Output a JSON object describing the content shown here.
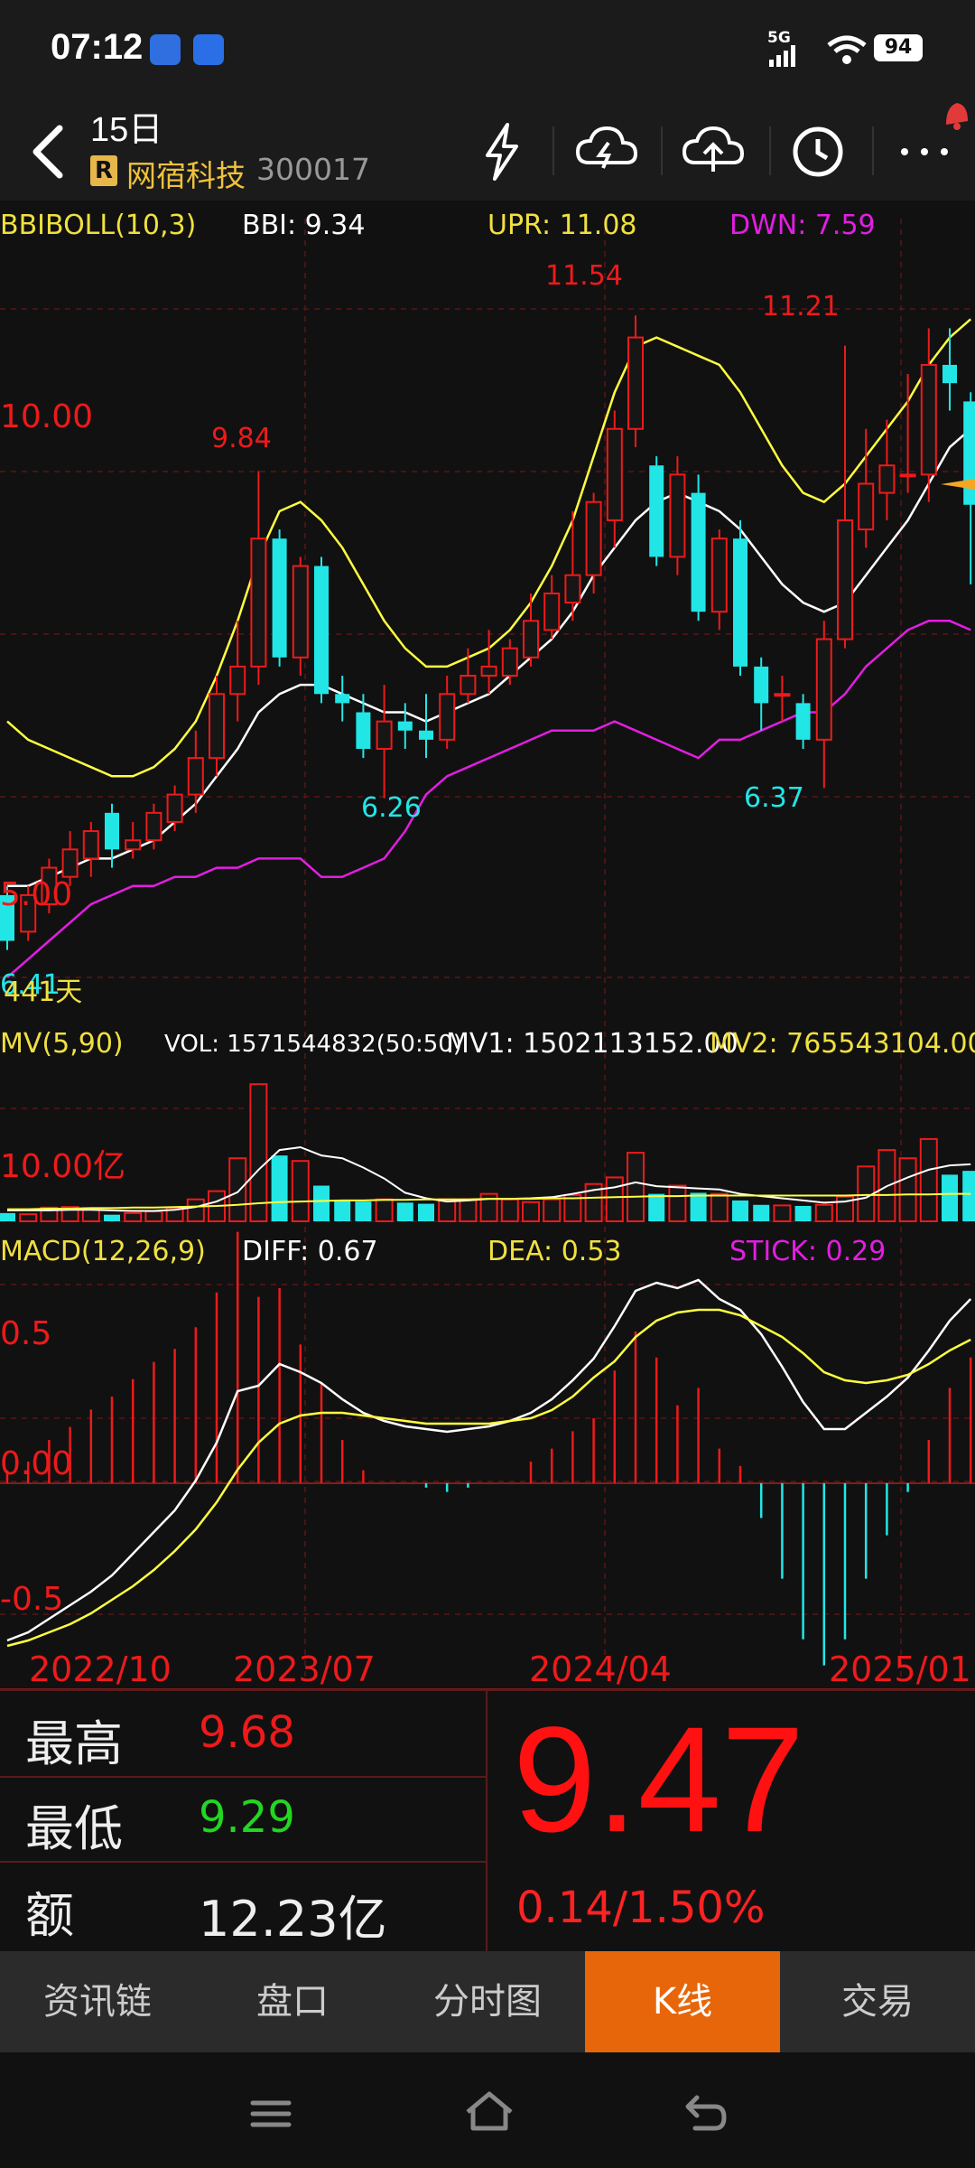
{
  "status": {
    "time": "07:12",
    "network": "5G",
    "battery": "94"
  },
  "header": {
    "period": "15日",
    "badge": "R",
    "stock_name": "网宿科技",
    "stock_code": "300017"
  },
  "indicators": {
    "boll": {
      "name": "BBIBOLL(10,3)",
      "bbi": "BBI: 9.34",
      "upr": "UPR: 11.08",
      "dwn": "DWN: 7.59"
    },
    "mv": {
      "name": "MV(5,90)",
      "vol": "VOL: 1571544832(50:50)",
      "mv1": "MV1: 1502113152.00",
      "mv2": "MV2: 765543104.00"
    },
    "macd": {
      "name": "MACD(12,26,9)",
      "diff": "DIFF: 0.67",
      "dea": "DEA: 0.53",
      "stick": "STICK: 0.29"
    }
  },
  "chart_labels": {
    "price_axis_high": "10.00",
    "price_axis_low": "5.00",
    "volume_axis": "10.00亿",
    "macd_axis_top": "0.5",
    "macd_axis_mid": "0.00",
    "macd_axis_bottom": "-0.5",
    "days_label": "441天",
    "peak_1": "9.84",
    "peak_2": "11.54",
    "peak_3": "11.21",
    "trough_1": "6.26",
    "trough_2": "6.37",
    "start_low": "6.41"
  },
  "chart_data": {
    "type": "candlestick",
    "x_ticks": [
      "2022/10",
      "2023/07",
      "2024/04",
      "2025/01"
    ],
    "price_ylim": [
      4.3,
      12.6
    ],
    "candles": [
      {
        "o": 5.2,
        "c": 4.7,
        "h": 5.3,
        "l": 4.6
      },
      {
        "o": 4.8,
        "c": 5.2,
        "h": 5.3,
        "l": 4.7
      },
      {
        "o": 5.1,
        "c": 5.5,
        "h": 5.6,
        "l": 5.0
      },
      {
        "o": 5.4,
        "c": 5.7,
        "h": 5.9,
        "l": 5.3
      },
      {
        "o": 5.6,
        "c": 5.9,
        "h": 6.0,
        "l": 5.4
      },
      {
        "o": 6.1,
        "c": 5.7,
        "h": 6.2,
        "l": 5.5
      },
      {
        "o": 5.7,
        "c": 5.8,
        "h": 6.0,
        "l": 5.6
      },
      {
        "o": 5.8,
        "c": 6.1,
        "h": 6.2,
        "l": 5.7
      },
      {
        "o": 6.0,
        "c": 6.3,
        "h": 6.4,
        "l": 5.9
      },
      {
        "o": 6.3,
        "c": 6.7,
        "h": 7.0,
        "l": 6.1
      },
      {
        "o": 6.7,
        "c": 7.4,
        "h": 7.6,
        "l": 6.5
      },
      {
        "o": 7.4,
        "c": 7.7,
        "h": 8.2,
        "l": 7.1
      },
      {
        "o": 7.7,
        "c": 9.1,
        "h": 9.84,
        "l": 7.5
      },
      {
        "o": 9.1,
        "c": 7.8,
        "h": 9.2,
        "l": 7.7
      },
      {
        "o": 7.8,
        "c": 8.8,
        "h": 8.9,
        "l": 7.6
      },
      {
        "o": 8.8,
        "c": 7.4,
        "h": 8.9,
        "l": 7.3
      },
      {
        "o": 7.4,
        "c": 7.3,
        "h": 7.6,
        "l": 7.1
      },
      {
        "o": 7.2,
        "c": 6.8,
        "h": 7.4,
        "l": 6.7
      },
      {
        "o": 6.8,
        "c": 7.1,
        "h": 7.5,
        "l": 6.26
      },
      {
        "o": 7.1,
        "c": 7.0,
        "h": 7.3,
        "l": 6.8
      },
      {
        "o": 7.0,
        "c": 6.9,
        "h": 7.4,
        "l": 6.7
      },
      {
        "o": 6.9,
        "c": 7.4,
        "h": 7.6,
        "l": 6.8
      },
      {
        "o": 7.4,
        "c": 7.6,
        "h": 7.9,
        "l": 7.3
      },
      {
        "o": 7.6,
        "c": 7.7,
        "h": 8.1,
        "l": 7.4
      },
      {
        "o": 7.6,
        "c": 7.9,
        "h": 8.0,
        "l": 7.5
      },
      {
        "o": 7.8,
        "c": 8.2,
        "h": 8.5,
        "l": 7.7
      },
      {
        "o": 8.1,
        "c": 8.5,
        "h": 8.7,
        "l": 8.0
      },
      {
        "o": 8.4,
        "c": 8.7,
        "h": 9.4,
        "l": 8.2
      },
      {
        "o": 8.7,
        "c": 9.5,
        "h": 9.6,
        "l": 8.5
      },
      {
        "o": 9.3,
        "c": 10.3,
        "h": 10.5,
        "l": 9.0
      },
      {
        "o": 10.3,
        "c": 11.3,
        "h": 11.54,
        "l": 10.1
      },
      {
        "o": 9.9,
        "c": 8.9,
        "h": 10.0,
        "l": 8.8
      },
      {
        "o": 8.9,
        "c": 9.8,
        "h": 10.0,
        "l": 8.7
      },
      {
        "o": 9.6,
        "c": 8.3,
        "h": 9.8,
        "l": 8.2
      },
      {
        "o": 8.3,
        "c": 9.1,
        "h": 9.2,
        "l": 8.1
      },
      {
        "o": 9.1,
        "c": 7.7,
        "h": 9.3,
        "l": 7.6
      },
      {
        "o": 7.7,
        "c": 7.3,
        "h": 7.8,
        "l": 7.0
      },
      {
        "o": 7.4,
        "c": 7.4,
        "h": 7.6,
        "l": 7.1
      },
      {
        "o": 7.3,
        "c": 6.9,
        "h": 7.4,
        "l": 6.8
      },
      {
        "o": 6.9,
        "c": 8.0,
        "h": 8.2,
        "l": 6.37
      },
      {
        "o": 8.0,
        "c": 9.3,
        "h": 11.21,
        "l": 7.9
      },
      {
        "o": 9.2,
        "c": 9.7,
        "h": 10.3,
        "l": 9.0
      },
      {
        "o": 9.6,
        "c": 9.9,
        "h": 10.4,
        "l": 9.3
      },
      {
        "o": 9.8,
        "c": 9.8,
        "h": 10.9,
        "l": 9.6
      },
      {
        "o": 9.8,
        "c": 11.0,
        "h": 11.4,
        "l": 9.5
      },
      {
        "o": 11.0,
        "c": 10.8,
        "h": 11.4,
        "l": 10.5
      },
      {
        "o": 10.6,
        "c": 9.47,
        "h": 10.7,
        "l": 8.6
      }
    ],
    "bbi": [
      5.3,
      5.3,
      5.4,
      5.5,
      5.6,
      5.6,
      5.7,
      5.8,
      6.0,
      6.2,
      6.5,
      6.8,
      7.2,
      7.4,
      7.5,
      7.5,
      7.4,
      7.3,
      7.2,
      7.2,
      7.1,
      7.2,
      7.3,
      7.4,
      7.6,
      7.8,
      8.0,
      8.3,
      8.7,
      9.0,
      9.3,
      9.5,
      9.6,
      9.5,
      9.4,
      9.2,
      8.9,
      8.6,
      8.4,
      8.3,
      8.4,
      8.7,
      9.0,
      9.3,
      9.7,
      10.1,
      10.3
    ],
    "upr": [
      7.1,
      6.9,
      6.8,
      6.7,
      6.6,
      6.5,
      6.5,
      6.6,
      6.8,
      7.1,
      7.6,
      8.2,
      8.9,
      9.4,
      9.5,
      9.3,
      9.0,
      8.6,
      8.2,
      7.9,
      7.7,
      7.7,
      7.8,
      7.9,
      8.1,
      8.4,
      8.8,
      9.3,
      10.0,
      10.7,
      11.2,
      11.3,
      11.2,
      11.1,
      11.0,
      10.7,
      10.3,
      9.9,
      9.6,
      9.5,
      9.7,
      10.0,
      10.3,
      10.6,
      11.0,
      11.3,
      11.5
    ],
    "dwn": [
      4.3,
      4.5,
      4.7,
      4.9,
      5.1,
      5.2,
      5.3,
      5.3,
      5.4,
      5.4,
      5.5,
      5.5,
      5.6,
      5.6,
      5.6,
      5.4,
      5.4,
      5.5,
      5.6,
      5.9,
      6.3,
      6.5,
      6.6,
      6.7,
      6.8,
      6.9,
      7.0,
      7.0,
      7.0,
      7.1,
      7.0,
      6.9,
      6.8,
      6.7,
      6.9,
      6.9,
      7.0,
      7.1,
      7.2,
      7.2,
      7.4,
      7.7,
      7.9,
      8.1,
      8.2,
      8.2,
      8.1
    ],
    "volume_ylim": [
      0,
      28
    ],
    "volume": [
      1.5,
      1.3,
      2.5,
      2.6,
      2.4,
      1.2,
      1.5,
      1.8,
      2.5,
      4.0,
      5.5,
      11.5,
      25.0,
      12.0,
      11.0,
      6.5,
      3.8,
      3.6,
      4.0,
      3.4,
      3.2,
      4.0,
      4.0,
      5.0,
      4.0,
      3.5,
      4.0,
      4.8,
      6.8,
      8.0,
      12.5,
      5.0,
      6.5,
      5.2,
      5.0,
      3.8,
      3.0,
      2.9,
      2.8,
      3.0,
      4.5,
      10.0,
      13.0,
      11.5,
      15.0,
      8.5,
      9.2
    ],
    "mv1": [
      2.0,
      2.0,
      2.0,
      2.1,
      2.1,
      2.0,
      1.9,
      1.9,
      2.1,
      2.6,
      3.6,
      5.3,
      9.4,
      13.0,
      13.5,
      12.0,
      11.5,
      9.8,
      7.8,
      5.2,
      4.2,
      3.6,
      3.8,
      4.1,
      4.1,
      4.2,
      4.4,
      5.0,
      5.7,
      6.2,
      7.1,
      6.4,
      6.2,
      6.0,
      5.8,
      5.0,
      4.6,
      4.2,
      3.8,
      3.4,
      3.6,
      4.3,
      6.4,
      8.0,
      9.4,
      10.2,
      10.4
    ],
    "mv2": [
      2.2,
      2.2,
      2.3,
      2.3,
      2.4,
      2.4,
      2.5,
      2.5,
      2.6,
      2.7,
      2.8,
      3.0,
      3.3,
      3.5,
      3.6,
      3.7,
      3.8,
      3.8,
      3.9,
      3.9,
      4.0,
      4.0,
      4.0,
      4.1,
      4.1,
      4.1,
      4.2,
      4.2,
      4.3,
      4.4,
      4.5,
      4.6,
      4.6,
      4.7,
      4.7,
      4.7,
      4.7,
      4.7,
      4.7,
      4.7,
      4.7,
      4.8,
      4.8,
      4.9,
      4.9,
      5.0,
      5.0
    ],
    "macd_ylim": [
      -0.6,
      0.8
    ],
    "diff": [
      -0.58,
      -0.55,
      -0.5,
      -0.45,
      -0.4,
      -0.34,
      -0.26,
      -0.18,
      -0.1,
      0.01,
      0.15,
      0.34,
      0.36,
      0.44,
      0.41,
      0.37,
      0.31,
      0.26,
      0.23,
      0.21,
      0.2,
      0.19,
      0.2,
      0.21,
      0.23,
      0.26,
      0.31,
      0.38,
      0.46,
      0.58,
      0.71,
      0.74,
      0.72,
      0.75,
      0.68,
      0.64,
      0.55,
      0.43,
      0.3,
      0.2,
      0.2,
      0.26,
      0.32,
      0.39,
      0.49,
      0.6,
      0.68
    ],
    "dea": [
      -0.6,
      -0.58,
      -0.55,
      -0.52,
      -0.48,
      -0.43,
      -0.38,
      -0.32,
      -0.25,
      -0.17,
      -0.07,
      0.05,
      0.15,
      0.22,
      0.25,
      0.26,
      0.26,
      0.25,
      0.24,
      0.23,
      0.22,
      0.22,
      0.22,
      0.22,
      0.23,
      0.24,
      0.27,
      0.32,
      0.39,
      0.45,
      0.54,
      0.6,
      0.63,
      0.64,
      0.64,
      0.62,
      0.58,
      0.54,
      0.48,
      0.41,
      0.38,
      0.37,
      0.38,
      0.4,
      0.44,
      0.49,
      0.53
    ],
    "stick": [
      0.03,
      0.05,
      0.1,
      0.13,
      0.17,
      0.2,
      0.24,
      0.28,
      0.31,
      0.36,
      0.44,
      0.58,
      0.43,
      0.45,
      0.32,
      0.23,
      0.1,
      0.03,
      0.0,
      0.0,
      -0.01,
      -0.02,
      -0.01,
      0.0,
      0.0,
      0.05,
      0.08,
      0.12,
      0.15,
      0.26,
      0.35,
      0.29,
      0.18,
      0.22,
      0.08,
      0.04,
      -0.08,
      -0.22,
      -0.36,
      -0.42,
      -0.36,
      -0.22,
      -0.12,
      -0.02,
      0.1,
      0.22,
      0.29
    ]
  },
  "quote": {
    "high_label": "最高",
    "high_value": "9.68",
    "low_label": "最低",
    "low_value": "9.29",
    "amount_label": "额",
    "amount_value": "12.23亿",
    "price": "9.47",
    "change": "0.14/1.50%"
  },
  "tabs": [
    "资讯链",
    "盘口",
    "分时图",
    "K线",
    "交易"
  ],
  "active_tab": "K线",
  "colors": {
    "up": "#ee1a1a",
    "down": "#22e6e6",
    "active_tab": "#e8660a",
    "boll_upper": "#ffff40",
    "boll_mid": "#ffffff",
    "boll_lower": "#e21ee2"
  }
}
